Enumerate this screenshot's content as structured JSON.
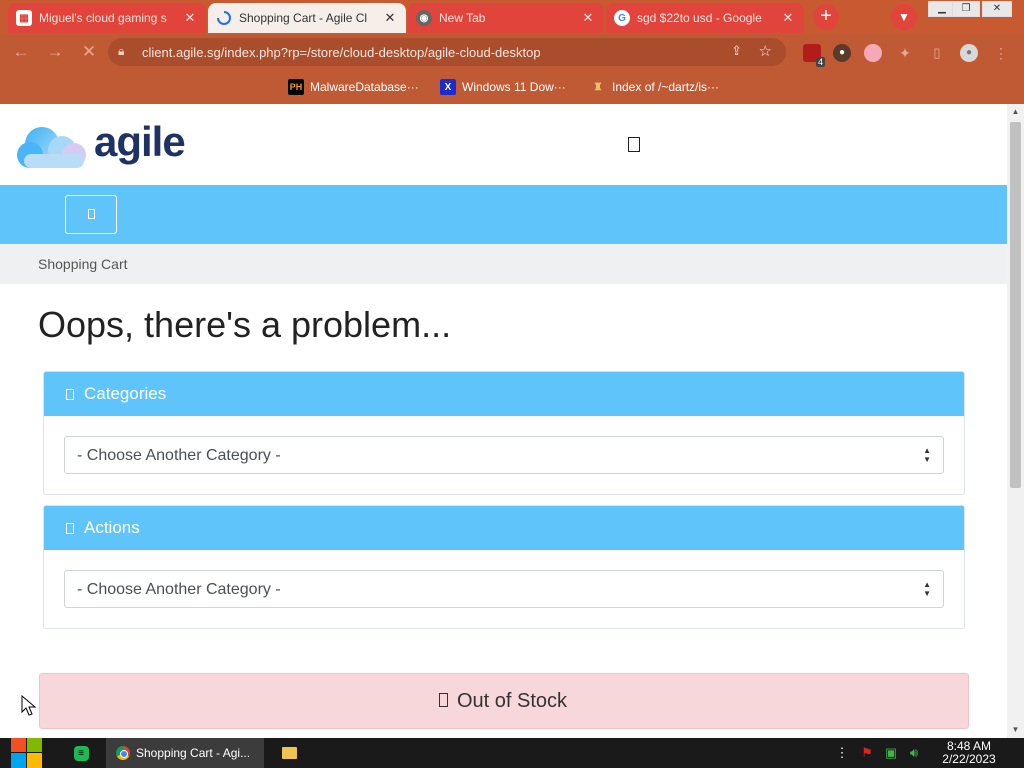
{
  "browser": {
    "tabs": [
      {
        "title": "Miguel's cloud gaming s",
        "close": "✕"
      },
      {
        "title": "Shopping Cart - Agile Cl",
        "close": "✕"
      },
      {
        "title": "New Tab",
        "close": "✕"
      },
      {
        "title": "sgd $22to usd - Google",
        "close": "✕"
      }
    ],
    "new_tab": "+",
    "url": "client.agile.sg/index.php?rp=/store/cloud-desktop/agile-cloud-desktop",
    "extension_badge": "4",
    "bookmarks": [
      {
        "label": "MalwareDatabase···",
        "icon": "PH"
      },
      {
        "label": "Windows 11 Dow···",
        "icon": "X"
      },
      {
        "label": "Index of /~dartz/is···",
        "icon": "yellow-figure-icon"
      }
    ]
  },
  "site": {
    "logo": "agile",
    "breadcrumb": "Shopping Cart",
    "page_title": "Oops, there's a problem...",
    "panels": [
      {
        "title": "Categories",
        "select_value": "- Choose Another Category -"
      },
      {
        "title": "Actions",
        "select_value": "- Choose Another Category -"
      }
    ],
    "out_of_stock": "Out of Stock"
  },
  "taskbar": {
    "chrome_window": "Shopping Cart - Agi...",
    "time": "8:48 AM",
    "date": "2/22/2023"
  },
  "colors": {
    "accent": "#5fc4fa",
    "logo": "#1e3363",
    "browser_frame": "#c05a35",
    "alert_bg": "#f8d7da"
  }
}
